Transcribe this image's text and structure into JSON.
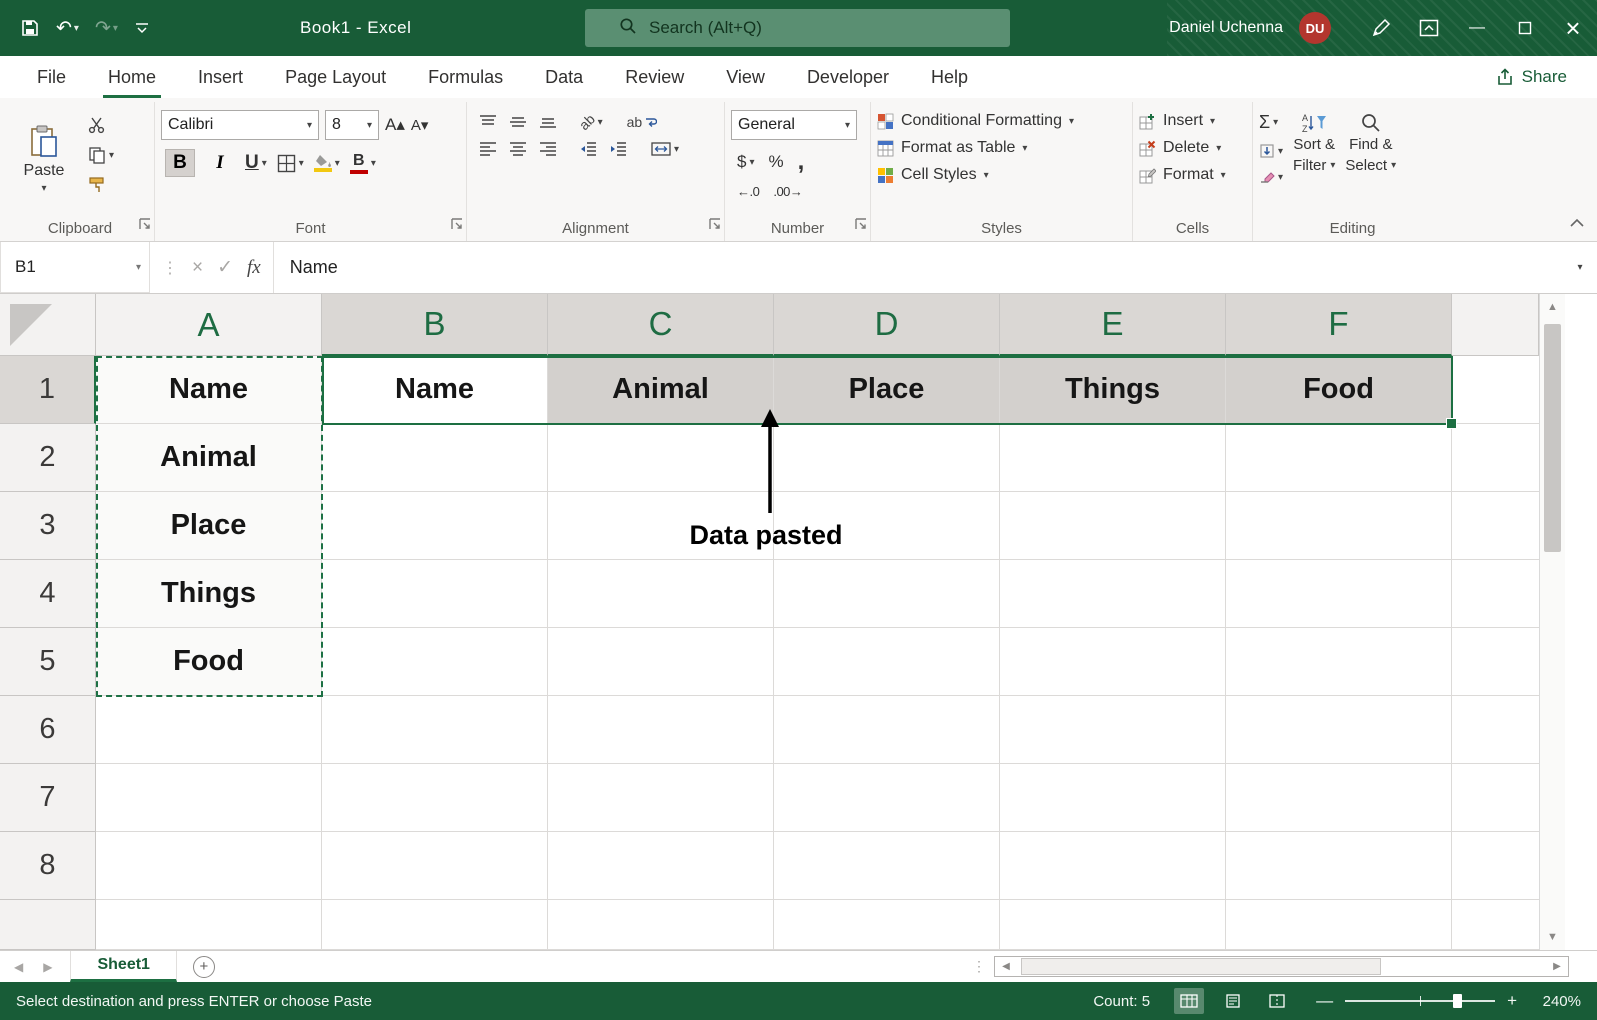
{
  "title_bar": {
    "title": "Book1  -  Excel",
    "search_placeholder": "Search (Alt+Q)",
    "user_name": "Daniel Uchenna",
    "user_initials": "DU"
  },
  "icons": {
    "chevron_down": "▾",
    "undo": "↶",
    "redo": "↷",
    "minimize": "—",
    "close": "×",
    "cancel": "×",
    "enter": "✓",
    "fx": "fx",
    "bold": "B",
    "italic": "I",
    "underline": "U",
    "grow_font": "A▴",
    "shrink_font": "A▾",
    "wrap_ab": "ab",
    "orientation_ab": "ab",
    "sigma": "Σ",
    "dollar": "$",
    "percent": "%",
    "comma": ",",
    "increase_decimal": "←.0",
    "decrease_decimal": ".00→",
    "dots": "⋮",
    "up_arrow": "▲",
    "down_arrow": "▼",
    "left_arrow": "◀",
    "right_arrow": "▶",
    "plus": "+",
    "minus": "—"
  },
  "tabs": {
    "file": "File",
    "home": "Home",
    "insert": "Insert",
    "page_layout": "Page Layout",
    "formulas": "Formulas",
    "data": "Data",
    "review": "Review",
    "view": "View",
    "developer": "Developer",
    "help": "Help",
    "share": "Share"
  },
  "ribbon": {
    "paste": "Paste",
    "clipboard_label": "Clipboard",
    "font_name": "Calibri",
    "font_size": "8",
    "font_label": "Font",
    "alignment_label": "Alignment",
    "number_format": "General",
    "number_label": "Number",
    "conditional_formatting": "Conditional Formatting",
    "format_as_table": "Format as Table",
    "cell_styles": "Cell Styles",
    "styles_label": "Styles",
    "insert": "Insert",
    "delete": "Delete",
    "format": "Format",
    "cells_label": "Cells",
    "sort_line1": "Sort &",
    "sort_line2": "Filter",
    "find_line1": "Find &",
    "find_line2": "Select",
    "editing_label": "Editing"
  },
  "formula_bar": {
    "name_box": "B1",
    "value": "Name"
  },
  "grid": {
    "col_headers": [
      "A",
      "B",
      "C",
      "D",
      "E",
      "F"
    ],
    "row_headers": [
      "1",
      "2",
      "3",
      "4",
      "5",
      "6",
      "7",
      "8"
    ],
    "a1": "Name",
    "a2": "Animal",
    "a3": "Place",
    "a4": "Things",
    "a5": "Food",
    "b1": "Name",
    "c1": "Animal",
    "d1": "Place",
    "e1": "Things",
    "f1": "Food"
  },
  "annotation": {
    "label": "Data pasted"
  },
  "sheet_bar": {
    "sheet1": "Sheet1"
  },
  "status_bar": {
    "message": "Select destination and press ENTER or choose Paste",
    "count": "Count: 5",
    "zoom_level": "240%"
  }
}
